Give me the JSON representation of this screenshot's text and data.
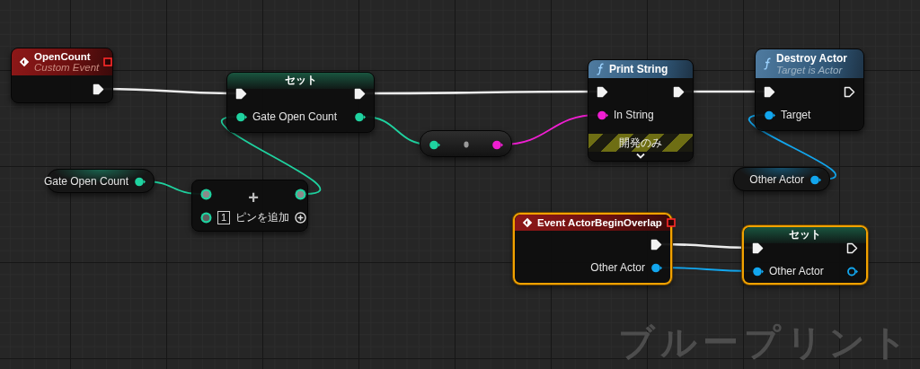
{
  "nodes": [
    {
      "kind": "event",
      "title": "OpenCount",
      "subtitle": "Custom Event",
      "selected": false,
      "rows": [
        {
          "out": {
            "kind": "exec",
            "connected": true
          }
        }
      ]
    },
    {
      "kind": "set",
      "title": "セット",
      "selected": false,
      "rows": [
        {
          "in": {
            "kind": "exec",
            "connected": true
          },
          "out": {
            "kind": "exec",
            "connected": true
          }
        },
        {
          "in": {
            "kind": "data",
            "label": "Gate Open Count",
            "color": "#1fd3a0",
            "connected": true
          },
          "out": {
            "kind": "data",
            "color": "#1fd3a0",
            "connected": true
          }
        }
      ]
    },
    {
      "kind": "function",
      "title": "Print String",
      "selected": false,
      "rows": [
        {
          "in": {
            "kind": "exec",
            "connected": true
          },
          "out": {
            "kind": "exec",
            "connected": true
          }
        },
        {
          "in": {
            "kind": "data",
            "label": "In String",
            "color": "#f01ed2",
            "connected": true
          }
        }
      ],
      "dev_only": "開発のみ"
    },
    {
      "kind": "function",
      "title": "Destroy Actor",
      "subtitle": "Target is Actor",
      "selected": false,
      "rows": [
        {
          "in": {
            "kind": "exec",
            "connected": true
          },
          "out": {
            "kind": "exec",
            "connected": false
          }
        },
        {
          "in": {
            "kind": "data",
            "label": "Target",
            "color": "#12a6ee",
            "connected": true
          }
        }
      ]
    },
    {
      "kind": "getter",
      "selected": false,
      "rows": [
        {
          "out": {
            "kind": "data",
            "label": "Gate Open Count",
            "color": "#1fd3a0",
            "connected": true
          }
        }
      ]
    },
    {
      "kind": "math",
      "symbol": "+",
      "selected": false,
      "rows": [
        {
          "in": {
            "kind": "operand",
            "color": "#1fd3a0",
            "connected": true
          },
          "out": {
            "kind": "operand",
            "color": "#1fd3a0",
            "connected": true
          }
        },
        {
          "in": {
            "kind": "operand",
            "color": "#1fd3a0",
            "connected": false
          },
          "index": "1"
        }
      ],
      "add_pin": "ピンを追加"
    },
    {
      "kind": "conversion",
      "selected": false,
      "rows": [
        {
          "in": {
            "kind": "data",
            "color": "#1fd3a0",
            "connected": true
          },
          "out": {
            "kind": "data",
            "color": "#f01ed2",
            "connected": true
          }
        }
      ]
    },
    {
      "kind": "getter",
      "selected": false,
      "rows": [
        {
          "out": {
            "kind": "data",
            "label": "Other Actor",
            "color": "#12a6ee",
            "connected": true
          }
        }
      ]
    },
    {
      "kind": "event",
      "title": "Event ActorBeginOverlap",
      "selected": true,
      "rows": [
        {
          "out": {
            "kind": "exec",
            "connected": true
          }
        },
        {
          "out": {
            "kind": "data",
            "label": "Other Actor",
            "color": "#12a6ee",
            "connected": true
          }
        }
      ]
    },
    {
      "kind": "set",
      "title": "セット",
      "selected": true,
      "rows": [
        {
          "in": {
            "kind": "exec",
            "connected": true
          },
          "out": {
            "kind": "exec",
            "connected": false
          }
        },
        {
          "in": {
            "kind": "data",
            "label": "Other Actor",
            "color": "#12a6ee",
            "connected": true
          },
          "out": {
            "kind": "data",
            "color": "#12a6ee",
            "connected": false
          }
        }
      ]
    }
  ],
  "graph_label": "ブループリント"
}
